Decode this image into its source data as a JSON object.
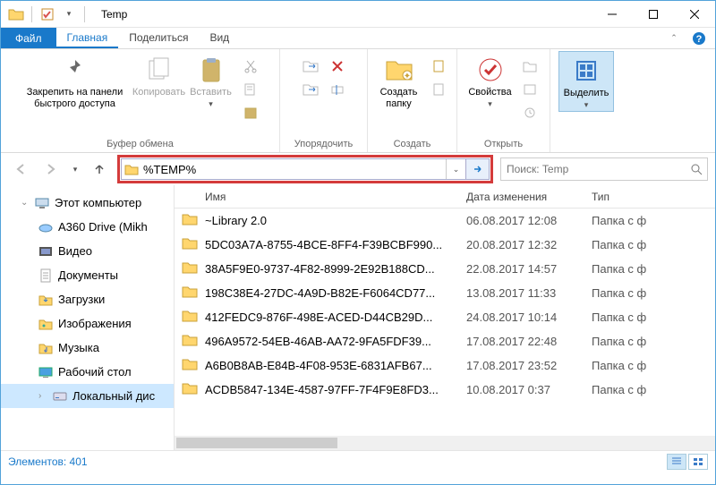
{
  "window": {
    "title": "Temp"
  },
  "file_tab": "Файл",
  "tabs": [
    "Главная",
    "Поделиться",
    "Вид"
  ],
  "ribbon": {
    "clipboard_group": "Буфер обмена",
    "organize_group": "Упорядочить",
    "new_group": "Создать",
    "open_group": "Открыть",
    "select_group": "Выделить",
    "pin_label": "Закрепить на панели быстрого доступа",
    "copy_label": "Копировать",
    "paste_label": "Вставить",
    "new_folder_label": "Создать папку",
    "properties_label": "Свойства",
    "select_label": "Выделить"
  },
  "address": {
    "value": "%TEMP%"
  },
  "search": {
    "placeholder": "Поиск: Temp"
  },
  "columns": {
    "name": "Имя",
    "date": "Дата изменения",
    "type": "Тип"
  },
  "sidebar": {
    "items": [
      {
        "label": "Этот компьютер",
        "icon": "pc"
      },
      {
        "label": "A360 Drive (Mikh",
        "icon": "a360"
      },
      {
        "label": "Видео",
        "icon": "video"
      },
      {
        "label": "Документы",
        "icon": "docs"
      },
      {
        "label": "Загрузки",
        "icon": "downloads"
      },
      {
        "label": "Изображения",
        "icon": "images"
      },
      {
        "label": "Музыка",
        "icon": "music"
      },
      {
        "label": "Рабочий стол",
        "icon": "desktop"
      },
      {
        "label": "Локальный дис",
        "icon": "disk"
      }
    ]
  },
  "files": [
    {
      "name": "~Library 2.0",
      "date": "06.08.2017 12:08",
      "type": "Папка с ф"
    },
    {
      "name": "5DC03A7A-8755-4BCE-8FF4-F39BCBF990...",
      "date": "20.08.2017 12:32",
      "type": "Папка с ф"
    },
    {
      "name": "38A5F9E0-9737-4F82-8999-2E92B188CD...",
      "date": "22.08.2017 14:57",
      "type": "Папка с ф"
    },
    {
      "name": "198C38E4-27DC-4A9D-B82E-F6064CD77...",
      "date": "13.08.2017 11:33",
      "type": "Папка с ф"
    },
    {
      "name": "412FEDC9-876F-498E-ACED-D44CB29D...",
      "date": "24.08.2017 10:14",
      "type": "Папка с ф"
    },
    {
      "name": "496A9572-54EB-46AB-AA72-9FA5FDF39...",
      "date": "17.08.2017 22:48",
      "type": "Папка с ф"
    },
    {
      "name": "A6B0B8AB-E84B-4F08-953E-6831AFB67...",
      "date": "17.08.2017 23:52",
      "type": "Папка с ф"
    },
    {
      "name": "ACDB5847-134E-4587-97FF-7F4F9E8FD3...",
      "date": "10.08.2017 0:37",
      "type": "Папка с ф"
    }
  ],
  "status": {
    "text": "Элементов: 401"
  }
}
